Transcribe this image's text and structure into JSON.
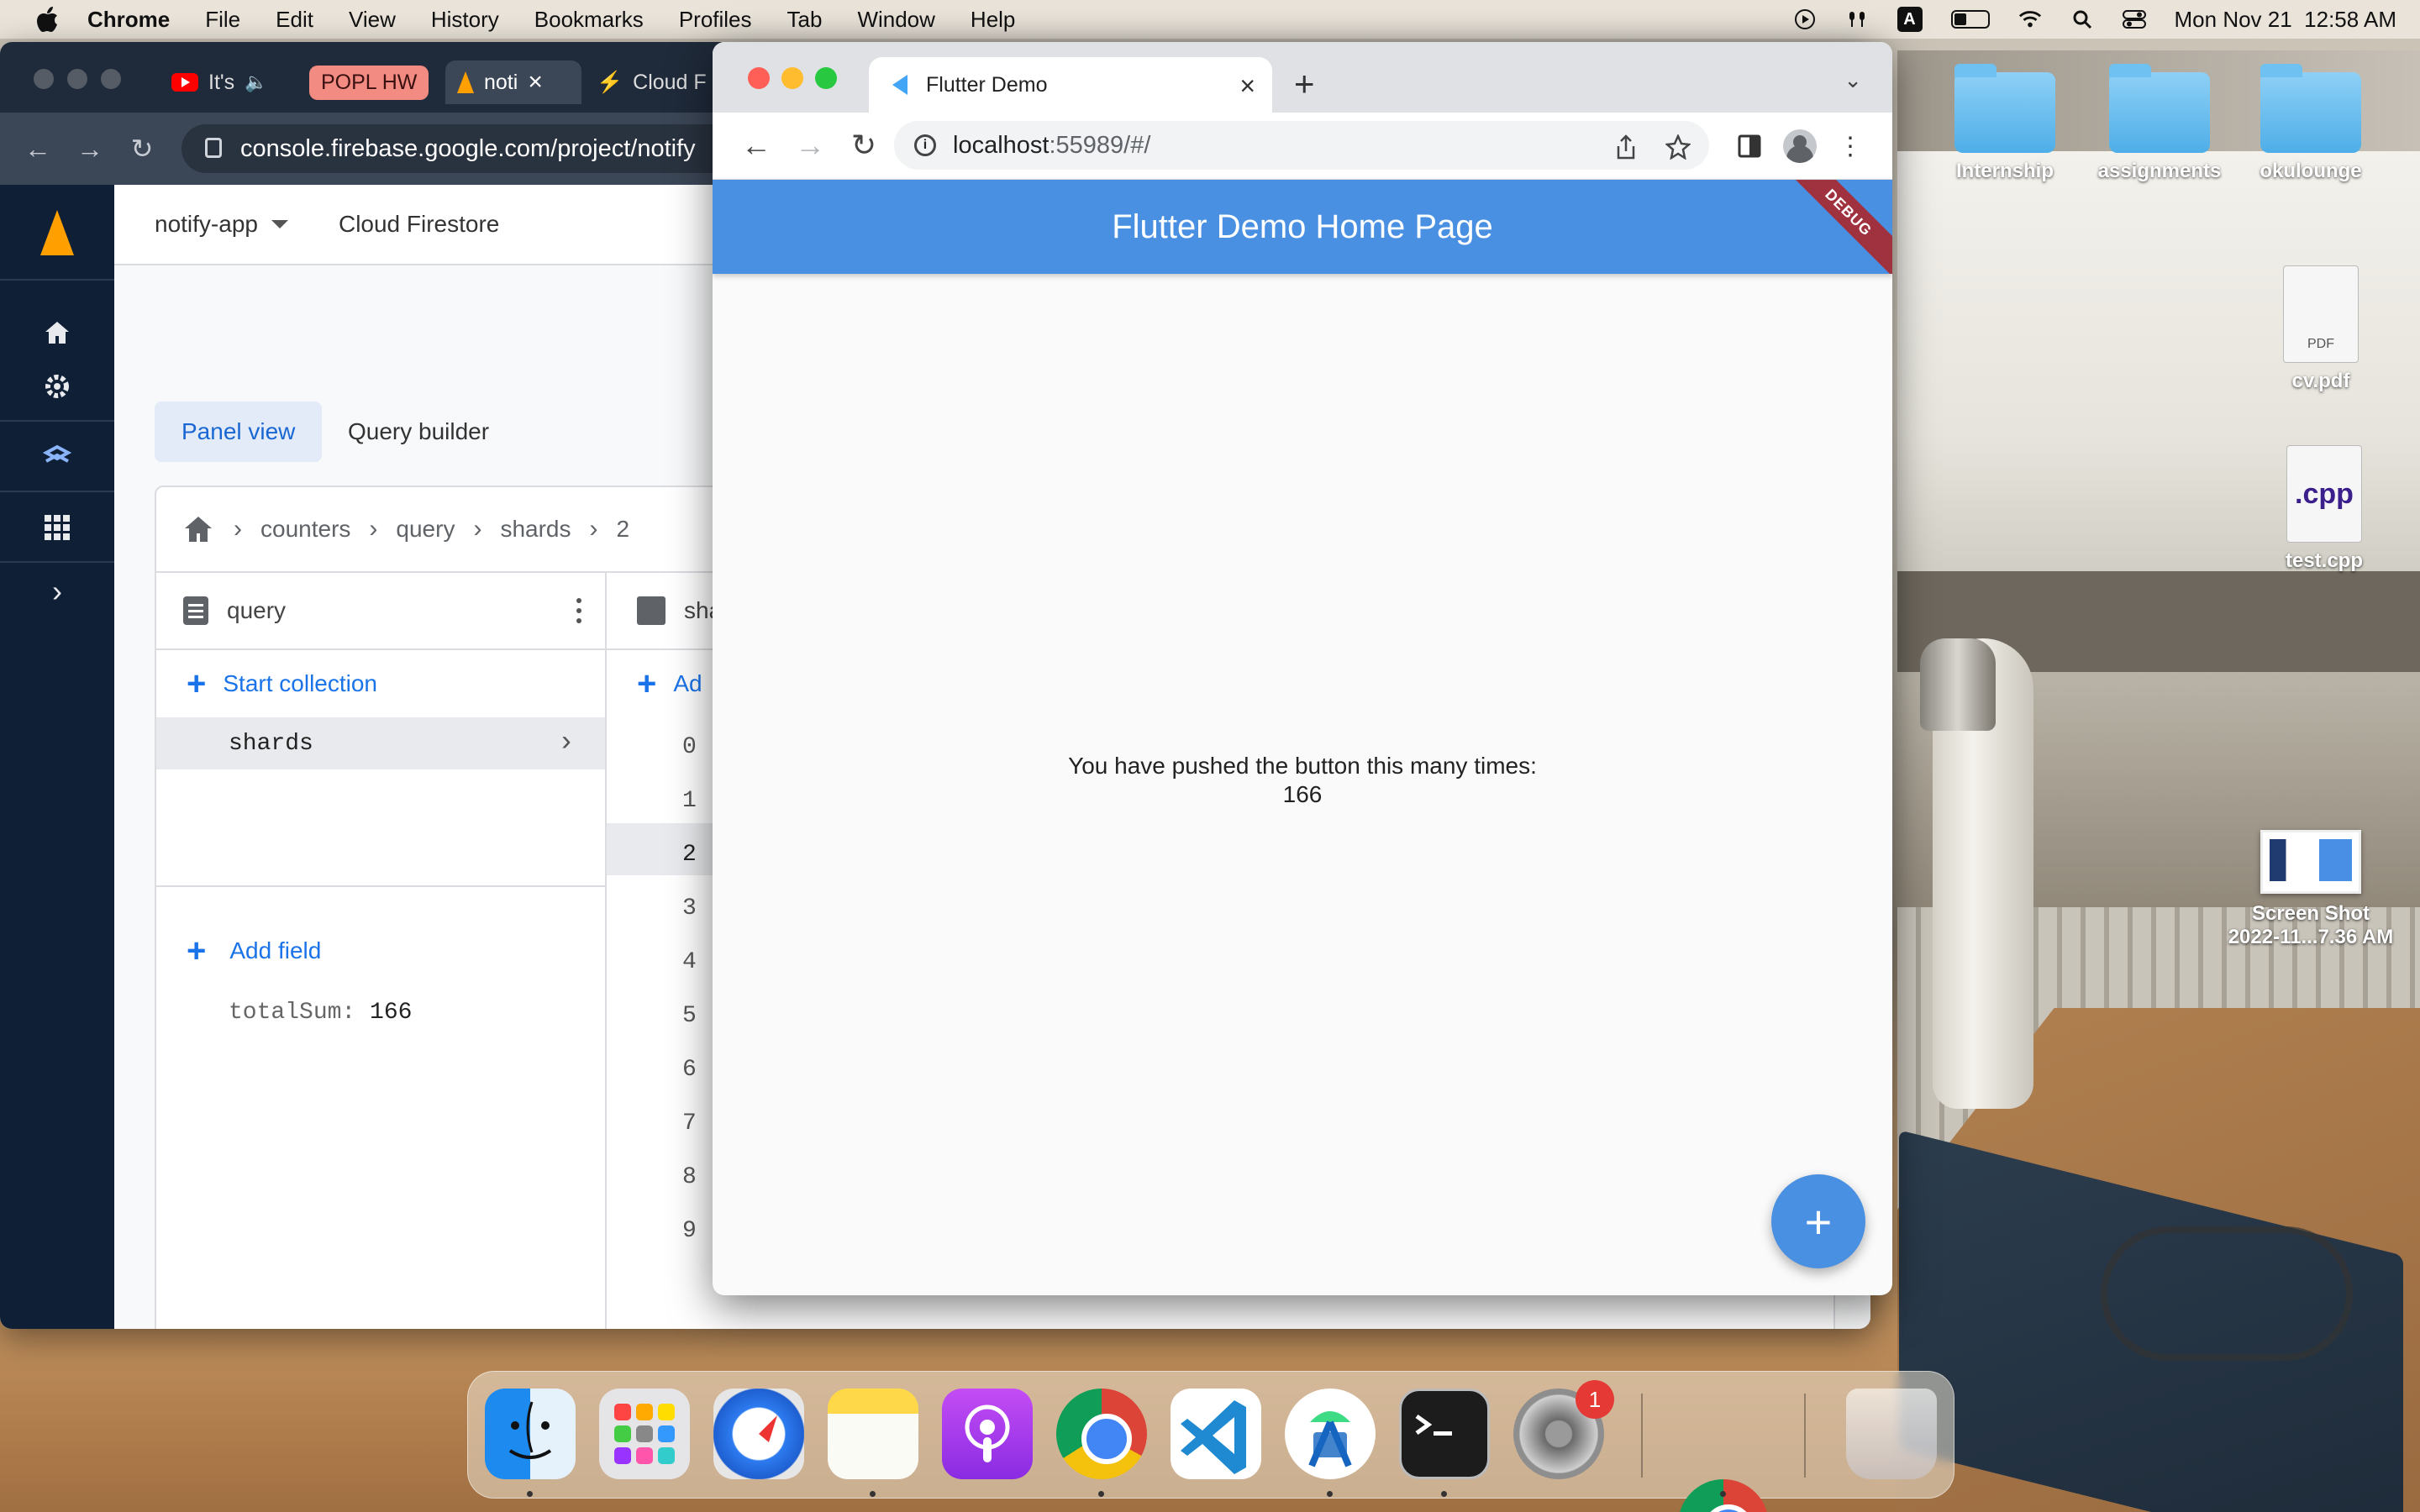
{
  "menubar": {
    "app": "Chrome",
    "items": [
      "File",
      "Edit",
      "View",
      "History",
      "Bookmarks",
      "Profiles",
      "Tab",
      "Window",
      "Help"
    ],
    "input_indicator": "A",
    "clock": "Mon Nov 21  12:58 AM"
  },
  "desktop": {
    "folders": [
      "Internship",
      "assignments",
      "okulounge"
    ],
    "files": [
      {
        "name": "cv.pdf",
        "badge": "PDF"
      },
      {
        "name": "test.cpp",
        "badge": ".cpp"
      }
    ],
    "screenshot": {
      "line1": "Screen Shot",
      "line2": "2022-11...7.36 AM"
    }
  },
  "back_window": {
    "tabs": [
      {
        "label": "It's"
      },
      {
        "label": "POPL HW"
      },
      {
        "label": "noti"
      },
      {
        "label": "Cloud F"
      }
    ],
    "url": "console.firebase.google.com/project/notify",
    "firebase": {
      "project": "notify-app",
      "product": "Cloud Firestore",
      "view_active": "Panel view",
      "view_other": "Query builder",
      "breadcrumb": [
        "counters",
        "query",
        "shards",
        "2"
      ],
      "col1_title": "query",
      "start_collection": "Start collection",
      "collections": [
        "shards"
      ],
      "add_field": "Add field",
      "field_key": "totalSum:",
      "field_value": "166",
      "col2_title": "sha",
      "col2_add": "Ad",
      "shard_ids": [
        "0",
        "1",
        "2",
        "3",
        "4",
        "5",
        "6",
        "7",
        "8",
        "9"
      ],
      "selected_shard": "2"
    }
  },
  "front_window": {
    "tab_title": "Flutter Demo",
    "url_host": "localhost",
    "url_path": ":55989/#/",
    "app_title": "Flutter Demo Home Page",
    "debug_banner": "DEBUG",
    "counter_label": "You have pushed the button this many times:",
    "counter_value": "166",
    "fab_label": "+"
  },
  "dock": {
    "settings_badge": "1"
  },
  "colors": {
    "flutter_blue": "#4a90e2",
    "firebase_nav": "#0f1f35",
    "link_blue": "#1a73e8",
    "debug_red": "#a0313f"
  }
}
